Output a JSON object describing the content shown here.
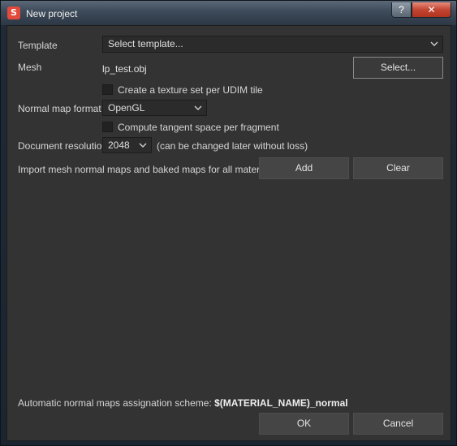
{
  "window": {
    "title": "New project",
    "help_label": "?",
    "close_label": "✕",
    "app_icon_glyph": "S"
  },
  "form": {
    "template_label": "Template",
    "template_value": "Select template...",
    "mesh_label": "Mesh",
    "mesh_value": "lp_test.obj",
    "select_button": "Select...",
    "udim_checkbox_label": "Create a texture set per UDIM tile",
    "udim_checked": false,
    "normal_map_format_label": "Normal map format",
    "normal_map_format_value": "OpenGL",
    "tangent_checkbox_label": "Compute tangent space per fragment",
    "tangent_checked": false,
    "doc_resolution_label": "Document resolution",
    "doc_resolution_value": "2048",
    "doc_resolution_note": "(can be changed later without loss)",
    "import_label": "Import mesh normal maps and baked maps for all materials.",
    "add_button": "Add",
    "clear_button": "Clear"
  },
  "footer": {
    "scheme_label": "Automatic normal maps assignation scheme:",
    "scheme_value": "$(MATERIAL_NAME)_normal",
    "ok_button": "OK",
    "cancel_button": "Cancel"
  },
  "icons": {
    "app": "substance-painter-icon",
    "dropdown": "chevron-down-icon"
  }
}
